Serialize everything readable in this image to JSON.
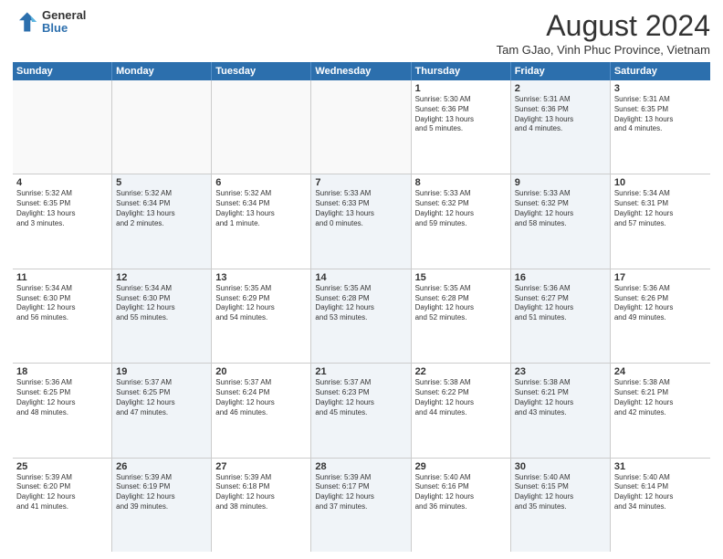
{
  "header": {
    "logo_general": "General",
    "logo_blue": "Blue",
    "month_title": "August 2024",
    "location": "Tam GJao, Vinh Phuc Province, Vietnam"
  },
  "weekdays": [
    "Sunday",
    "Monday",
    "Tuesday",
    "Wednesday",
    "Thursday",
    "Friday",
    "Saturday"
  ],
  "rows": [
    [
      {
        "day": "",
        "text": ""
      },
      {
        "day": "",
        "text": ""
      },
      {
        "day": "",
        "text": ""
      },
      {
        "day": "",
        "text": ""
      },
      {
        "day": "1",
        "text": "Sunrise: 5:30 AM\nSunset: 6:36 PM\nDaylight: 13 hours\nand 5 minutes."
      },
      {
        "day": "2",
        "text": "Sunrise: 5:31 AM\nSunset: 6:36 PM\nDaylight: 13 hours\nand 4 minutes."
      },
      {
        "day": "3",
        "text": "Sunrise: 5:31 AM\nSunset: 6:35 PM\nDaylight: 13 hours\nand 4 minutes."
      }
    ],
    [
      {
        "day": "4",
        "text": "Sunrise: 5:32 AM\nSunset: 6:35 PM\nDaylight: 13 hours\nand 3 minutes."
      },
      {
        "day": "5",
        "text": "Sunrise: 5:32 AM\nSunset: 6:34 PM\nDaylight: 13 hours\nand 2 minutes."
      },
      {
        "day": "6",
        "text": "Sunrise: 5:32 AM\nSunset: 6:34 PM\nDaylight: 13 hours\nand 1 minute."
      },
      {
        "day": "7",
        "text": "Sunrise: 5:33 AM\nSunset: 6:33 PM\nDaylight: 13 hours\nand 0 minutes."
      },
      {
        "day": "8",
        "text": "Sunrise: 5:33 AM\nSunset: 6:32 PM\nDaylight: 12 hours\nand 59 minutes."
      },
      {
        "day": "9",
        "text": "Sunrise: 5:33 AM\nSunset: 6:32 PM\nDaylight: 12 hours\nand 58 minutes."
      },
      {
        "day": "10",
        "text": "Sunrise: 5:34 AM\nSunset: 6:31 PM\nDaylight: 12 hours\nand 57 minutes."
      }
    ],
    [
      {
        "day": "11",
        "text": "Sunrise: 5:34 AM\nSunset: 6:30 PM\nDaylight: 12 hours\nand 56 minutes."
      },
      {
        "day": "12",
        "text": "Sunrise: 5:34 AM\nSunset: 6:30 PM\nDaylight: 12 hours\nand 55 minutes."
      },
      {
        "day": "13",
        "text": "Sunrise: 5:35 AM\nSunset: 6:29 PM\nDaylight: 12 hours\nand 54 minutes."
      },
      {
        "day": "14",
        "text": "Sunrise: 5:35 AM\nSunset: 6:28 PM\nDaylight: 12 hours\nand 53 minutes."
      },
      {
        "day": "15",
        "text": "Sunrise: 5:35 AM\nSunset: 6:28 PM\nDaylight: 12 hours\nand 52 minutes."
      },
      {
        "day": "16",
        "text": "Sunrise: 5:36 AM\nSunset: 6:27 PM\nDaylight: 12 hours\nand 51 minutes."
      },
      {
        "day": "17",
        "text": "Sunrise: 5:36 AM\nSunset: 6:26 PM\nDaylight: 12 hours\nand 49 minutes."
      }
    ],
    [
      {
        "day": "18",
        "text": "Sunrise: 5:36 AM\nSunset: 6:25 PM\nDaylight: 12 hours\nand 48 minutes."
      },
      {
        "day": "19",
        "text": "Sunrise: 5:37 AM\nSunset: 6:25 PM\nDaylight: 12 hours\nand 47 minutes."
      },
      {
        "day": "20",
        "text": "Sunrise: 5:37 AM\nSunset: 6:24 PM\nDaylight: 12 hours\nand 46 minutes."
      },
      {
        "day": "21",
        "text": "Sunrise: 5:37 AM\nSunset: 6:23 PM\nDaylight: 12 hours\nand 45 minutes."
      },
      {
        "day": "22",
        "text": "Sunrise: 5:38 AM\nSunset: 6:22 PM\nDaylight: 12 hours\nand 44 minutes."
      },
      {
        "day": "23",
        "text": "Sunrise: 5:38 AM\nSunset: 6:21 PM\nDaylight: 12 hours\nand 43 minutes."
      },
      {
        "day": "24",
        "text": "Sunrise: 5:38 AM\nSunset: 6:21 PM\nDaylight: 12 hours\nand 42 minutes."
      }
    ],
    [
      {
        "day": "25",
        "text": "Sunrise: 5:39 AM\nSunset: 6:20 PM\nDaylight: 12 hours\nand 41 minutes."
      },
      {
        "day": "26",
        "text": "Sunrise: 5:39 AM\nSunset: 6:19 PM\nDaylight: 12 hours\nand 39 minutes."
      },
      {
        "day": "27",
        "text": "Sunrise: 5:39 AM\nSunset: 6:18 PM\nDaylight: 12 hours\nand 38 minutes."
      },
      {
        "day": "28",
        "text": "Sunrise: 5:39 AM\nSunset: 6:17 PM\nDaylight: 12 hours\nand 37 minutes."
      },
      {
        "day": "29",
        "text": "Sunrise: 5:40 AM\nSunset: 6:16 PM\nDaylight: 12 hours\nand 36 minutes."
      },
      {
        "day": "30",
        "text": "Sunrise: 5:40 AM\nSunset: 6:15 PM\nDaylight: 12 hours\nand 35 minutes."
      },
      {
        "day": "31",
        "text": "Sunrise: 5:40 AM\nSunset: 6:14 PM\nDaylight: 12 hours\nand 34 minutes."
      }
    ]
  ]
}
